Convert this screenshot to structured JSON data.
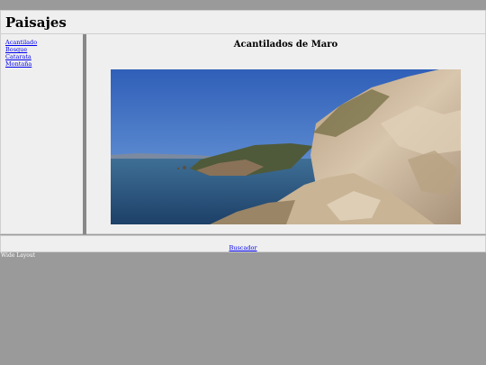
{
  "header": {
    "title": "Paisajes"
  },
  "sidebar": {
    "items": [
      {
        "label": "Acantilado"
      },
      {
        "label": "Bosque"
      },
      {
        "label": "Catarata"
      },
      {
        "label": "Montaña"
      }
    ]
  },
  "main": {
    "heading": "Acantilados de Maro",
    "image": {
      "alt": "Acantilados de Maro"
    }
  },
  "footer": {
    "link_label": "Buscador"
  },
  "layout_label": "Wide Layout",
  "colors": {
    "page_bg": "#9a9a9a",
    "panel_bg": "#efefef",
    "divider": "#888888",
    "link": "#0000ee"
  }
}
